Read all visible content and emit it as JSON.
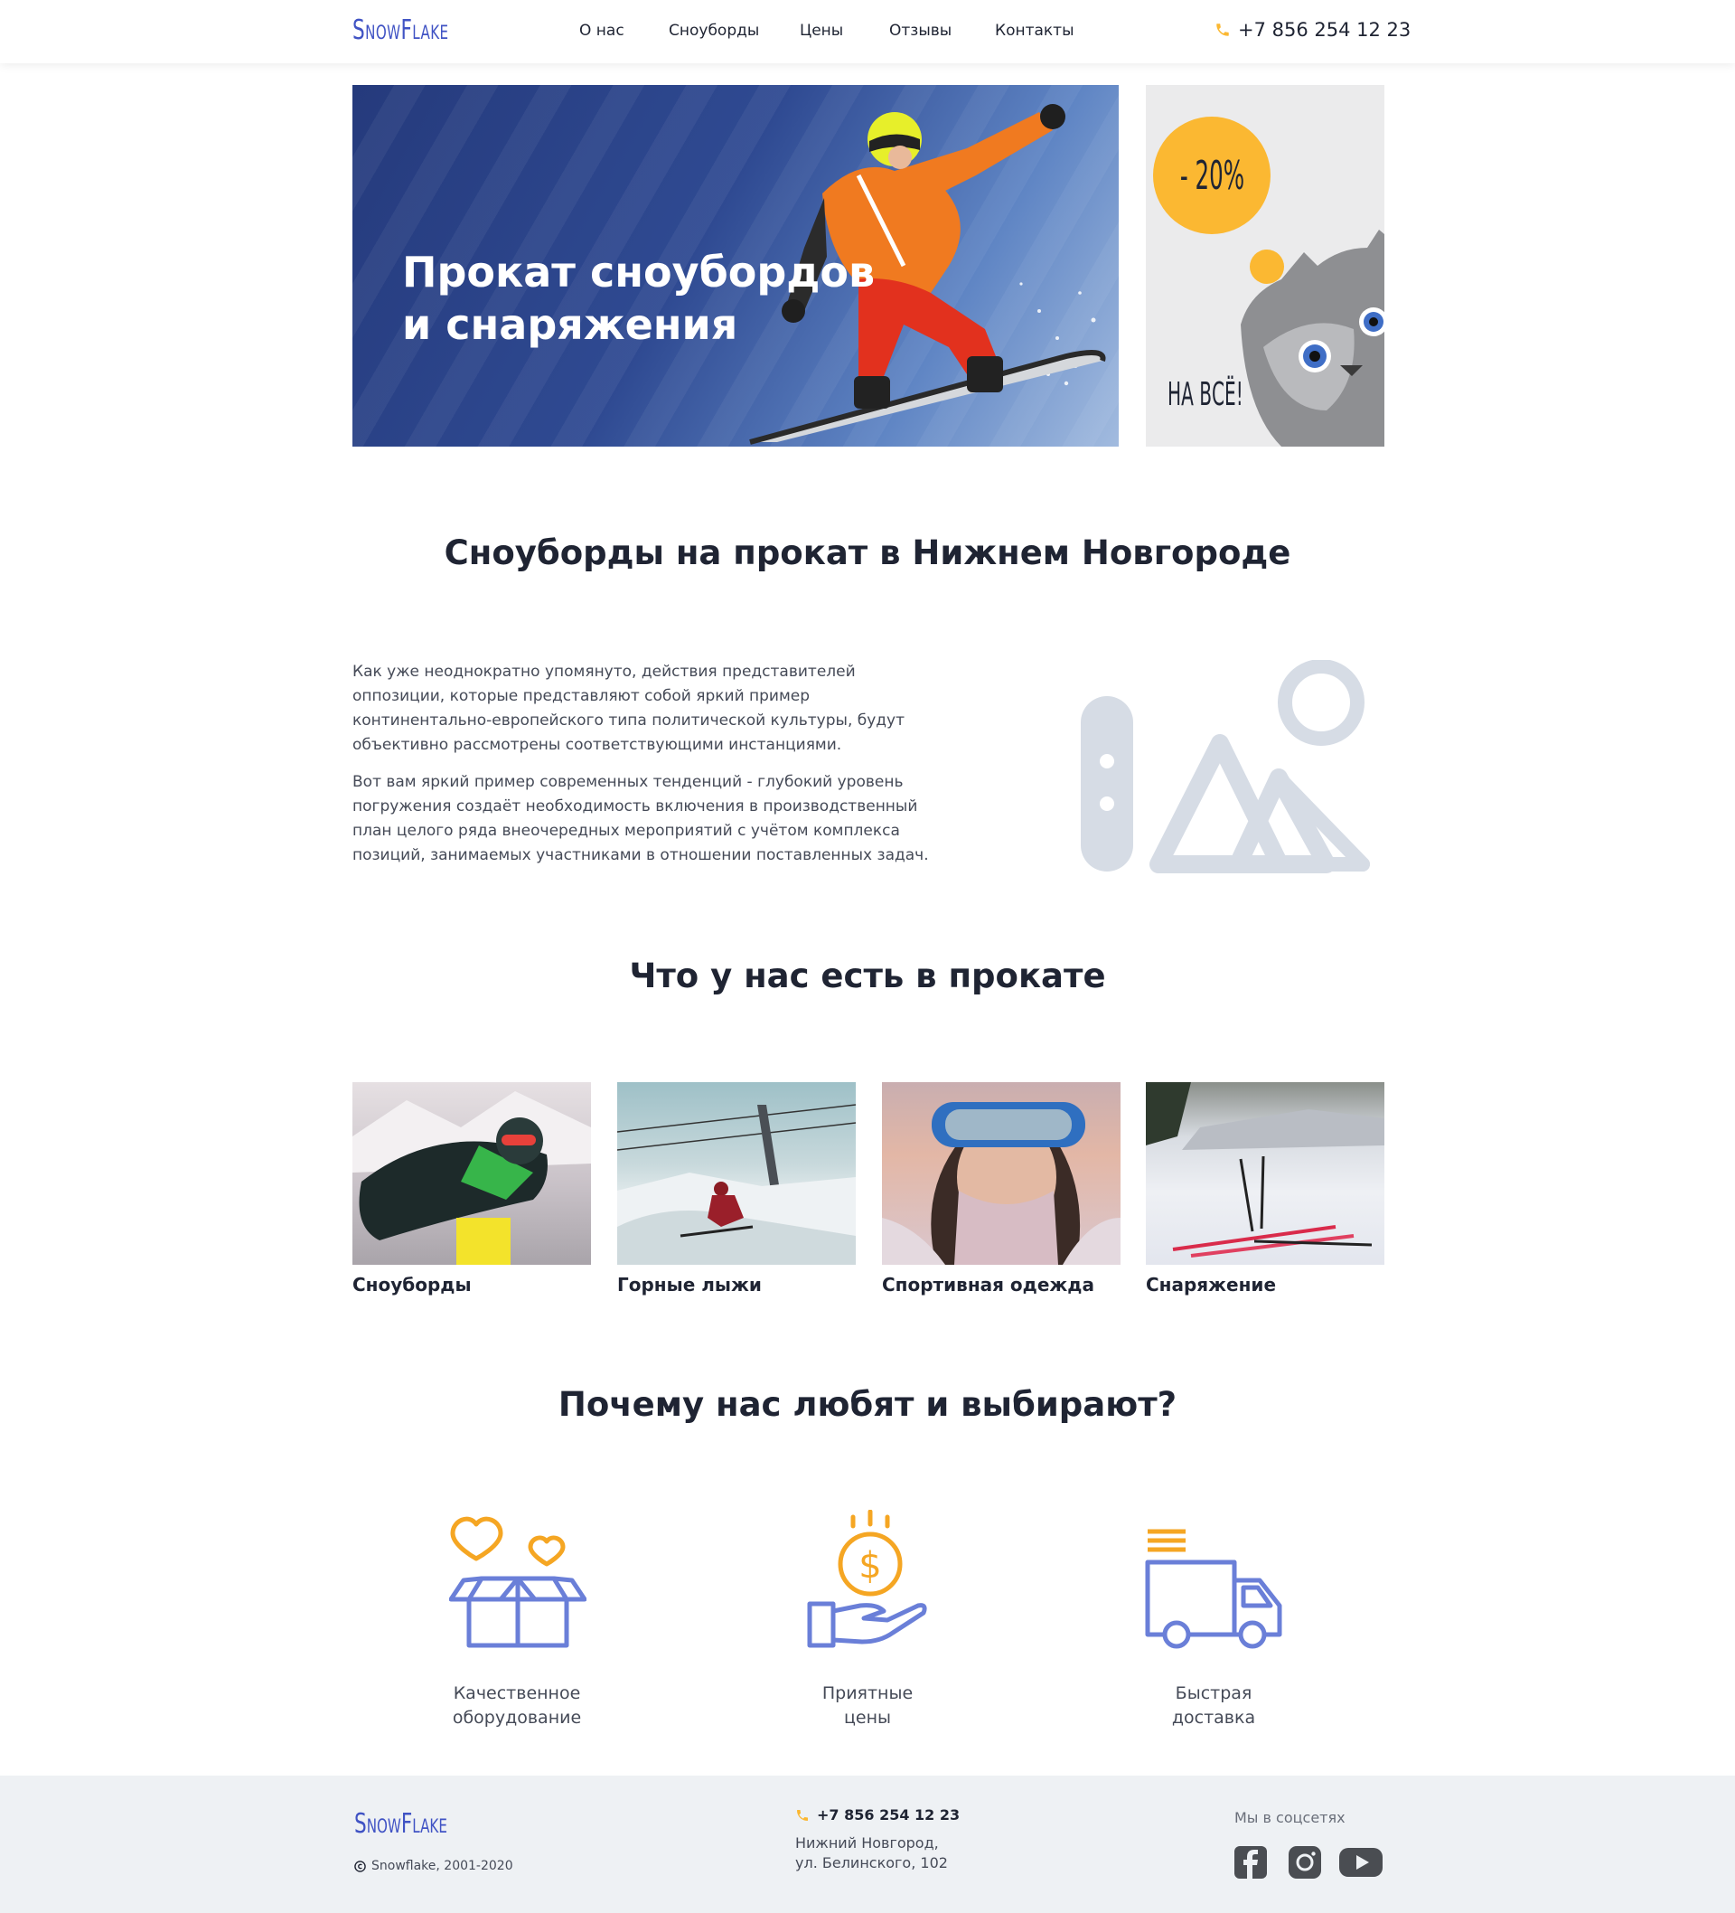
{
  "header": {
    "logo": "SnowFlake",
    "nav": [
      "О нас",
      "Сноуборды",
      "Цены",
      "Отзывы",
      "Контакты"
    ],
    "phone": "+7 856 254 12 23"
  },
  "hero": {
    "title": "Прокат сноубордов\nи снаряжения"
  },
  "promo": {
    "discount": "- 20%",
    "text": "НА ВСЁ!"
  },
  "about": {
    "title": "Сноуборды на прокат в Нижнем Новгороде",
    "paragraphs": [
      "Как уже неоднократно упомянуто, действия представителей оппозиции, которые представляют собой яркий пример континентально-европейского типа политической культуры, будут объективно рассмотрены соответствующими инстанциями.",
      "Вот вам яркий пример современных тенденций - глубокий уровень погружения создаёт необходимость включения в производственный план целого ряда внеочередных мероприятий с учётом комплекса позиций, занимаемых участниками в отношении поставленных задач."
    ]
  },
  "rental": {
    "title": "Что у нас есть в прокате",
    "items": [
      {
        "label": "Сноуборды"
      },
      {
        "label": "Горные лыжи"
      },
      {
        "label": "Спортивная одежда"
      },
      {
        "label": "Снаряжение"
      }
    ]
  },
  "why": {
    "title": "Почему нас любят и выбирают?",
    "features": [
      {
        "label": "Качественное\nоборудование",
        "icon": "gift-box-hearts-icon"
      },
      {
        "label": "Приятные\nцены",
        "icon": "coin-hand-icon"
      },
      {
        "label": "Быстрая\nдоставка",
        "icon": "delivery-truck-icon"
      }
    ]
  },
  "footer": {
    "logo": "SnowFlake",
    "copyright": "Snowflake, 2001-2020",
    "phone": "+7 856 254 12 23",
    "address": "Нижний Новгород,\nул. Белинского, 102",
    "social_title": "Мы в соцсетях",
    "social": [
      "facebook-icon",
      "instagram-icon",
      "youtube-icon"
    ]
  },
  "colors": {
    "accent": "#fbb832",
    "brand": "#4053c4",
    "icon_blue": "#6a7fd8",
    "dark": "#1f2433"
  }
}
